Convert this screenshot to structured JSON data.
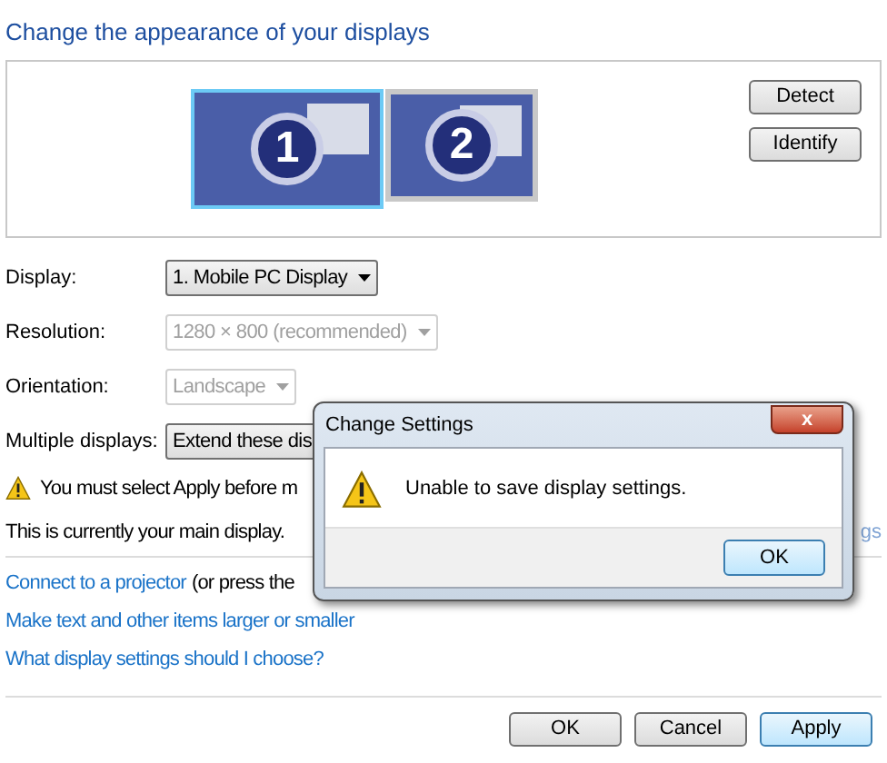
{
  "heading": "Change the appearance of your displays",
  "monitors": [
    {
      "number": "1",
      "selected": true
    },
    {
      "number": "2",
      "selected": false
    }
  ],
  "side_buttons": [
    "Detect",
    "Identify"
  ],
  "settings": [
    {
      "label": "Display:",
      "value": "1. Mobile PC Display",
      "disabled": false
    },
    {
      "label": "Resolution:",
      "value": "1280 × 800 (recommended)",
      "disabled": true
    },
    {
      "label": "Orientation:",
      "value": "Landscape",
      "disabled": true
    },
    {
      "label": "Multiple displays:",
      "value": "Extend these dis",
      "disabled": false
    }
  ],
  "warning": "You must select Apply before m",
  "main_display_note": "This is currently your main display.",
  "advanced_link": "gs",
  "links": [
    {
      "link": "Connect to a projector",
      "after": "(or press the"
    },
    {
      "link": "Make text and other items larger or smaller"
    },
    {
      "link": "What display settings should I choose?"
    }
  ],
  "buttons": [
    {
      "label": "OK",
      "default": false
    },
    {
      "label": "Cancel",
      "default": false
    },
    {
      "label": "Apply",
      "default": true
    }
  ],
  "dialog": {
    "title": "Change Settings",
    "close": "x",
    "message": "Unable to save display settings.",
    "button": "OK"
  }
}
